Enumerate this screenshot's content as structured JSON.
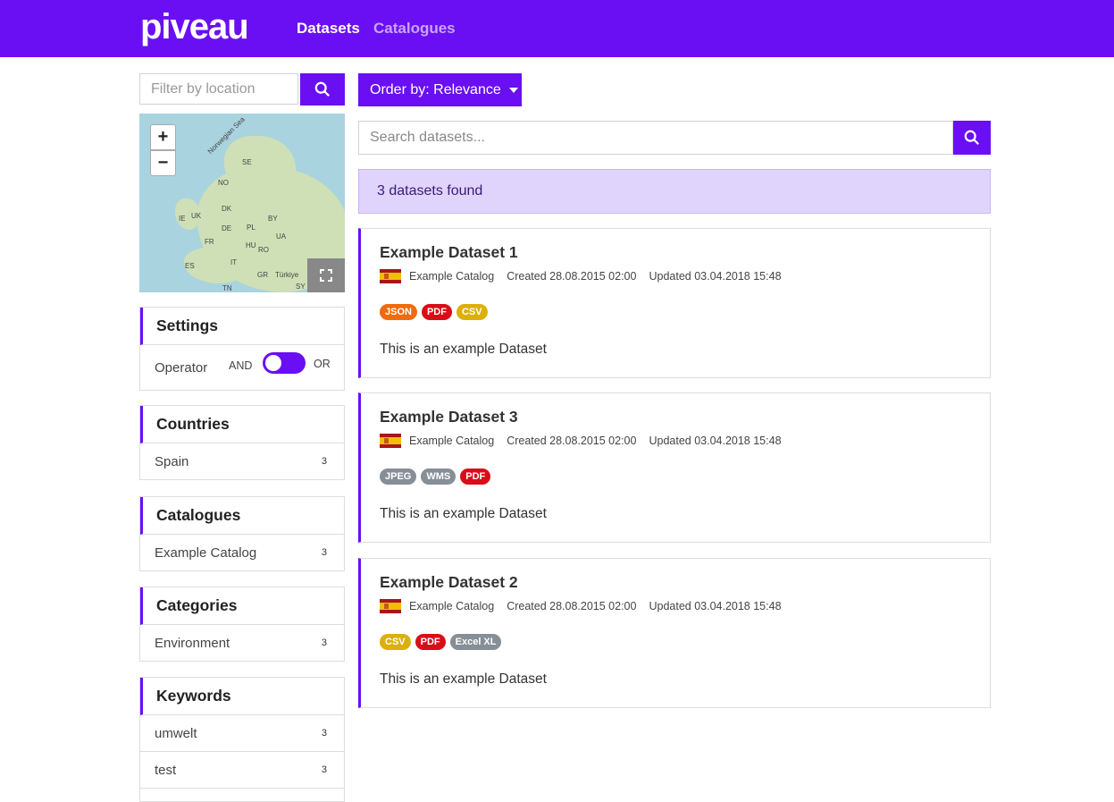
{
  "header": {
    "logo": "piveau",
    "nav": [
      "Datasets",
      "Catalogues"
    ]
  },
  "sidebar": {
    "filter_placeholder": "Filter by location",
    "map_labels": [
      "Norwegian Sea",
      "SE",
      "NO",
      "DK",
      "IE",
      "UK",
      "BY",
      "PL",
      "DE",
      "UA",
      "FR",
      "HU",
      "RO",
      "ES",
      "IT",
      "GR",
      "Türkiye",
      "TN",
      "SY"
    ],
    "settings": {
      "title": "Settings",
      "operator": "Operator",
      "and": "AND",
      "or": "OR"
    },
    "facets": [
      {
        "title": "Countries",
        "items": [
          {
            "label": "Spain",
            "count": "3"
          }
        ]
      },
      {
        "title": "Catalogues",
        "items": [
          {
            "label": "Example Catalog",
            "count": "3"
          }
        ]
      },
      {
        "title": "Categories",
        "items": [
          {
            "label": "Environment",
            "count": "3"
          }
        ]
      },
      {
        "title": "Keywords",
        "items": [
          {
            "label": "umwelt",
            "count": "3"
          },
          {
            "label": "test",
            "count": "3"
          }
        ]
      }
    ]
  },
  "main": {
    "order_label": "Order by: Relevance",
    "search_placeholder": "Search datasets...",
    "found_text": "3 datasets found",
    "datasets": [
      {
        "title": "Example Dataset 1",
        "catalog": "Example Catalog",
        "created": "Created 28.08.2015 02:00",
        "updated": "Updated 03.04.2018 15:48",
        "badges": [
          {
            "t": "JSON",
            "c": "#ee6b0e"
          },
          {
            "t": "PDF",
            "c": "#d90d17"
          },
          {
            "t": "CSV",
            "c": "#dbb00a"
          }
        ],
        "description": "This is an example Dataset"
      },
      {
        "title": "Example Dataset 3",
        "catalog": "Example Catalog",
        "created": "Created 28.08.2015 02:00",
        "updated": "Updated 03.04.2018 15:48",
        "badges": [
          {
            "t": "JPEG",
            "c": "#868e96"
          },
          {
            "t": "WMS",
            "c": "#868e96"
          },
          {
            "t": "PDF",
            "c": "#d90d17"
          }
        ],
        "description": "This is an example Dataset"
      },
      {
        "title": "Example Dataset 2",
        "catalog": "Example Catalog",
        "created": "Created 28.08.2015 02:00",
        "updated": "Updated 03.04.2018 15:48",
        "badges": [
          {
            "t": "CSV",
            "c": "#dbb00a"
          },
          {
            "t": "PDF",
            "c": "#d90d17"
          },
          {
            "t": "Excel XL",
            "c": "#868e96"
          }
        ],
        "description": "This is an example Dataset"
      }
    ]
  }
}
